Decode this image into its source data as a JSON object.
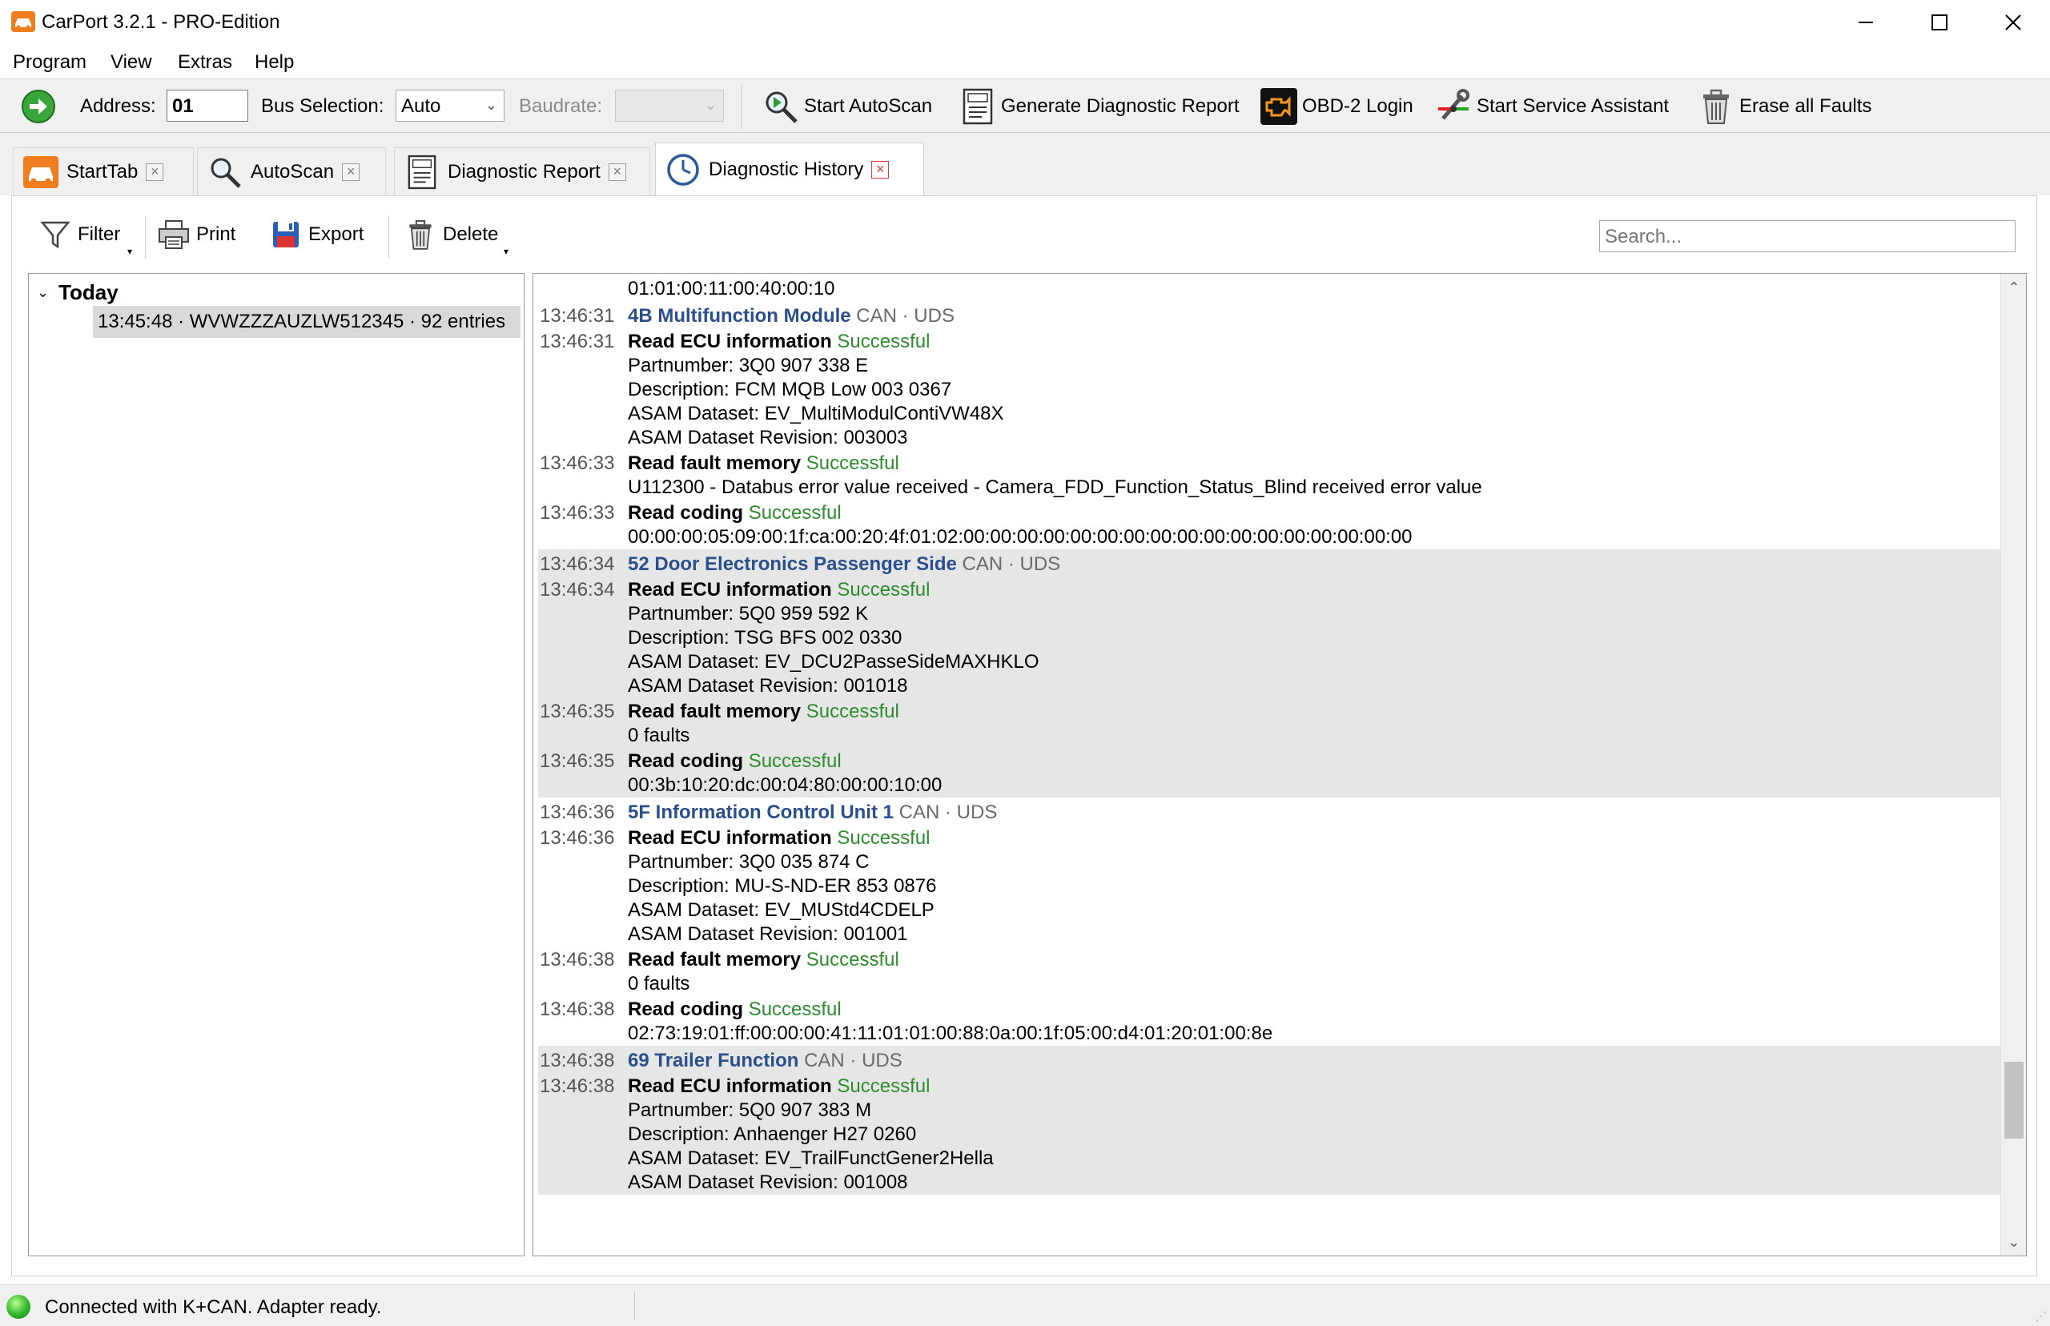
{
  "window": {
    "title": "CarPort 3.2.1 - PRO-Edition",
    "minimize": "—",
    "maximize": "☐",
    "close": "✕"
  },
  "menu": [
    "Program",
    "View",
    "Extras",
    "Help"
  ],
  "toolbar": {
    "address_label": "Address:",
    "address_value": "01",
    "bus_label": "Bus Selection:",
    "bus_value": "Auto",
    "baudrate_label": "Baudrate:",
    "baudrate_value": "",
    "autoscan": "Start AutoScan",
    "report": "Generate Diagnostic Report",
    "obd_login": "OBD-2 Login",
    "service": "Start Service Assistant",
    "erase": "Erase all Faults"
  },
  "tabs": [
    {
      "label": "StartTab",
      "active": false
    },
    {
      "label": "AutoScan",
      "active": false
    },
    {
      "label": "Diagnostic Report",
      "active": false
    },
    {
      "label": "Diagnostic History",
      "active": true
    }
  ],
  "subtoolbar": {
    "filter": "Filter",
    "print": "Print",
    "export": "Export",
    "delete": "Delete",
    "search_placeholder": "Search..."
  },
  "tree": {
    "group": "Today",
    "item": "13:45:48 · WVWZZZAUZLW512345 · 92 entries"
  },
  "log": {
    "top_line": "01:01:00:11:00:40:00:10",
    "blocks": [
      {
        "shade": false,
        "ts": "13:46:31",
        "module": "4B Multifunction Module",
        "proto": "CAN · UDS",
        "actions": [
          {
            "ts": "13:46:31",
            "name": "Read ECU information",
            "status": "Successful",
            "lines": [
              "Partnumber: 3Q0 907 338 E",
              "Description: FCM MQB Low 003 0367",
              "ASAM Dataset: EV_MultiModulContiVW48X",
              "ASAM Dataset Revision: 003003"
            ]
          },
          {
            "ts": "13:46:33",
            "name": "Read fault memory",
            "status": "Successful",
            "lines": [
              "U112300 - Databus error value received - Camera_FDD_Function_Status_Blind received error value"
            ]
          },
          {
            "ts": "13:46:33",
            "name": "Read coding",
            "status": "Successful",
            "lines": [
              "00:00:00:05:09:00:1f:ca:00:20:4f:01:02:00:00:00:00:00:00:00:00:00:00:00:00:00:00:00:00:00"
            ]
          }
        ]
      },
      {
        "shade": true,
        "ts": "13:46:34",
        "module": "52 Door Electronics Passenger Side",
        "proto": "CAN · UDS",
        "actions": [
          {
            "ts": "13:46:34",
            "name": "Read ECU information",
            "status": "Successful",
            "lines": [
              "Partnumber: 5Q0 959 592 K",
              "Description: TSG BFS 002 0330",
              "ASAM Dataset: EV_DCU2PasseSideMAXHKLO",
              "ASAM Dataset Revision: 001018"
            ]
          },
          {
            "ts": "13:46:35",
            "name": "Read fault memory",
            "status": "Successful",
            "lines": [
              "0 faults"
            ]
          },
          {
            "ts": "13:46:35",
            "name": "Read coding",
            "status": "Successful",
            "lines": [
              "00:3b:10:20:dc:00:04:80:00:00:10:00"
            ]
          }
        ]
      },
      {
        "shade": false,
        "ts": "13:46:36",
        "module": "5F Information Control Unit 1",
        "proto": "CAN · UDS",
        "actions": [
          {
            "ts": "13:46:36",
            "name": "Read ECU information",
            "status": "Successful",
            "lines": [
              "Partnumber: 3Q0 035 874 C",
              "Description: MU-S-ND-ER 853 0876",
              "ASAM Dataset: EV_MUStd4CDELP",
              "ASAM Dataset Revision: 001001"
            ]
          },
          {
            "ts": "13:46:38",
            "name": "Read fault memory",
            "status": "Successful",
            "lines": [
              "0 faults"
            ]
          },
          {
            "ts": "13:46:38",
            "name": "Read coding",
            "status": "Successful",
            "lines": [
              "02:73:19:01:ff:00:00:00:41:11:01:01:00:88:0a:00:1f:05:00:d4:01:20:01:00:8e"
            ]
          }
        ]
      },
      {
        "shade": true,
        "ts": "13:46:38",
        "module": "69 Trailer Function",
        "proto": "CAN · UDS",
        "actions": [
          {
            "ts": "13:46:38",
            "name": "Read ECU information",
            "status": "Successful",
            "lines": [
              "Partnumber: 5Q0 907 383 M",
              "Description: Anhaenger H27 0260",
              "ASAM Dataset: EV_TrailFunctGener2Hella",
              "ASAM Dataset Revision: 001008"
            ]
          }
        ]
      }
    ]
  },
  "status": {
    "text": "Connected with K+CAN. Adapter ready.",
    "led_color": "#2fb52f"
  },
  "colors": {
    "module_title": "#2a4f8a",
    "success": "#2e8b2e",
    "shaded_block": "#e6e6e6"
  }
}
